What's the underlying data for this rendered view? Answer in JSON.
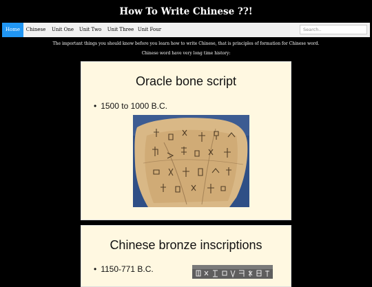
{
  "header": {
    "title": "How To Write Chinese ??!"
  },
  "nav": {
    "items": [
      "Home",
      "Chinese",
      "Unit One",
      "Unit Two",
      "Unit Three",
      "Unit Four"
    ],
    "active": "Home"
  },
  "search": {
    "placeholder": "Search.."
  },
  "intro": {
    "line1": "The important things you should know before you learn how to write Chinese, that is principles of formation for Chinese word.",
    "line2": "Chinese word have very long time history:"
  },
  "slides": [
    {
      "title": "Oracle bone script",
      "bullet": "1500 to 1000 B.C."
    },
    {
      "title": "Chinese bronze inscriptions",
      "bullet": "1150-771 B.C."
    }
  ],
  "colors": {
    "nav_active": "#2196F3",
    "slide_bg": "#fff8e1",
    "page_bg": "#000000"
  }
}
